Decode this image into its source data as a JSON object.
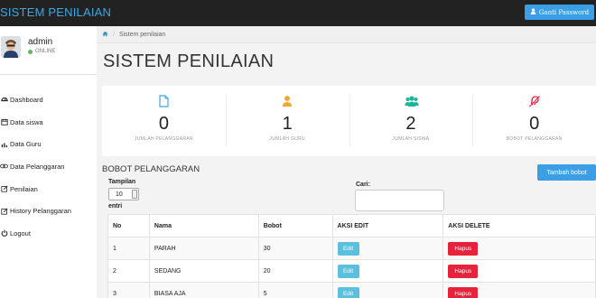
{
  "topbar": {
    "brand": "SISTEM PENILAIAN",
    "change_password_label": "Ganti Password"
  },
  "profile": {
    "name": "admin",
    "status": "ONLINE",
    "status_color": "#5cb85c"
  },
  "sidebar": {
    "items": [
      {
        "label": "Dashboard",
        "icon": "dashboard-icon"
      },
      {
        "label": "Data siswa",
        "icon": "calendar-icon"
      },
      {
        "label": "Data Guru",
        "icon": "bar-chart-icon"
      },
      {
        "label": "Data Pelanggaran",
        "icon": "link-icon"
      },
      {
        "label": "Penilaian",
        "icon": "edit-icon"
      },
      {
        "label": "History Pelanggaran",
        "icon": "edit-icon"
      },
      {
        "label": "Logout",
        "icon": "power-icon"
      }
    ]
  },
  "breadcrumb": {
    "home_icon": "home-icon",
    "current": "Sistem penilaian"
  },
  "page_title": "SISTEM PENILAIAN",
  "stats": [
    {
      "value": "0",
      "label": "JUMLAH PELANGGARAN",
      "icon": "file-icon",
      "color": "#3ca7e4"
    },
    {
      "value": "1",
      "label": "JUMLAH GURU",
      "icon": "user-icon",
      "color": "#f0a830"
    },
    {
      "value": "2",
      "label": "JUMLAH SISWA",
      "icon": "users-icon",
      "color": "#1bb69a"
    },
    {
      "value": "0",
      "label": "BOBOT PELANGGARAN",
      "icon": "deaf-icon",
      "color": "#e8213c"
    }
  ],
  "section": {
    "title": "BOBOT PELANGGARAN",
    "add_button": "Tambah bobot",
    "tampilan_label": "Tampilan",
    "page_size": "10",
    "entri_label": "entri",
    "search_label": "Cari:",
    "search_value": ""
  },
  "table": {
    "headers": [
      "No",
      "Nama",
      "Bobot",
      "AKSI EDIT",
      "AKSI DELETE"
    ],
    "edit_label": "Edit",
    "delete_label": "Hapus",
    "rows": [
      {
        "no": "1",
        "nama": "PARAH",
        "bobot": "30"
      },
      {
        "no": "2",
        "nama": "SEDANG",
        "bobot": "20"
      },
      {
        "no": "3",
        "nama": "BIASA AJA",
        "bobot": "5"
      }
    ]
  },
  "colors": {
    "topbar_bg": "#222222",
    "brand": "#3ca7e4",
    "primary_button": "#3c9fe6",
    "edit_button": "#5bc0de",
    "delete_button": "#e8213c"
  }
}
